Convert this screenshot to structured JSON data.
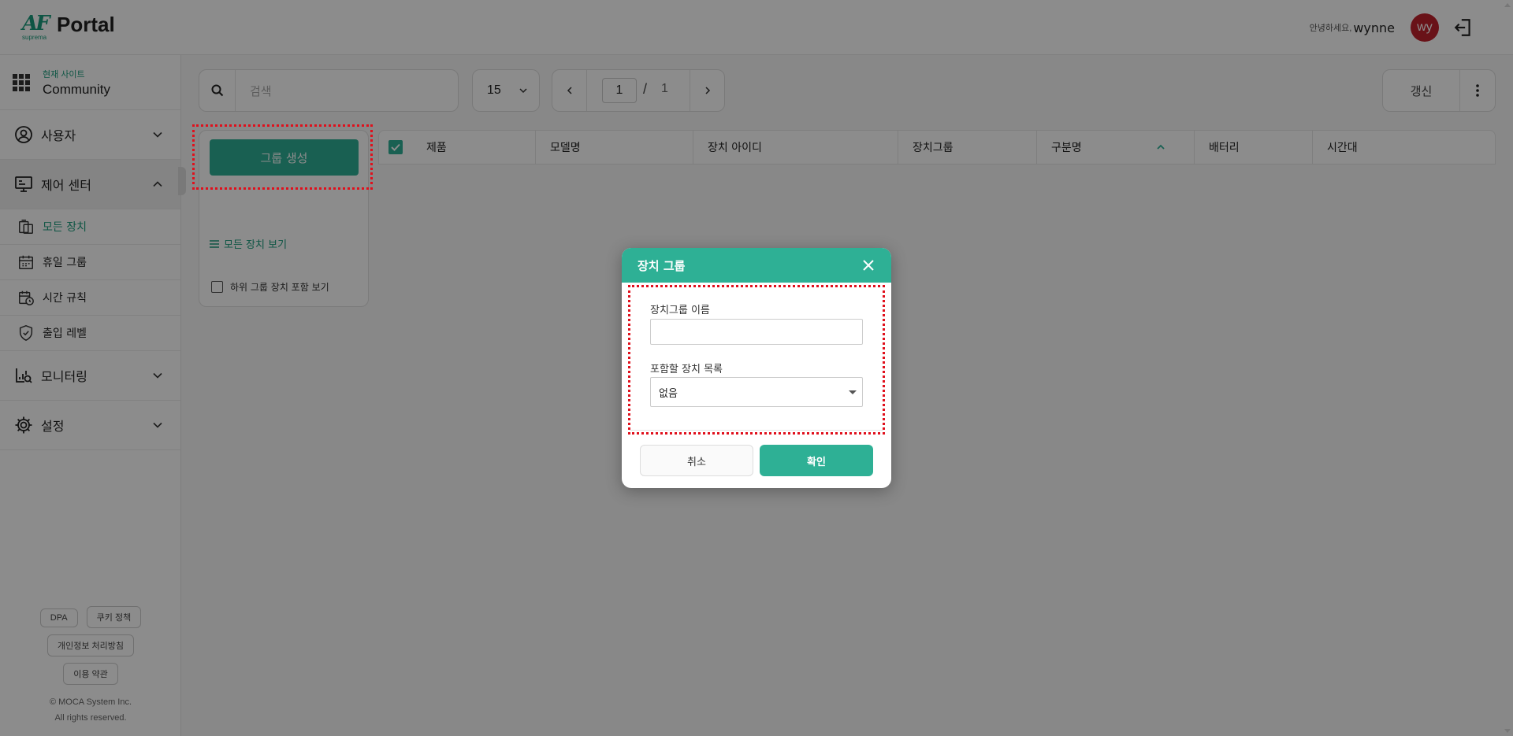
{
  "header": {
    "logo_sub": "suprema",
    "logo_text": "Portal",
    "greeting": "안녕하세요,",
    "username": "wynne",
    "avatar_initials": "wy"
  },
  "sidebar": {
    "site_label": "현재 사이트",
    "site_name": "Community",
    "items": [
      {
        "label": "사용자",
        "icon": "user-icon"
      },
      {
        "label": "제어 센터",
        "icon": "control-icon"
      },
      {
        "label": "모니터링",
        "icon": "monitor-icon"
      },
      {
        "label": "설정",
        "icon": "gear-icon"
      }
    ],
    "sub_items": [
      {
        "label": "모든 장치",
        "icon": "device-icon"
      },
      {
        "label": "휴일 그룹",
        "icon": "calendar-icon"
      },
      {
        "label": "시간 규칙",
        "icon": "time-rule-icon"
      },
      {
        "label": "출입 레벨",
        "icon": "shield-icon"
      }
    ],
    "footer": {
      "dpa": "DPA",
      "cookie": "쿠키 정책",
      "privacy": "개인정보 처리방침",
      "terms": "이용 약관",
      "copyright_line1": "© MOCA System Inc.",
      "copyright_line2": "All rights reserved."
    }
  },
  "toolbar": {
    "search_placeholder": "검색",
    "page_size": "15",
    "current_page": "1",
    "page_separator": "/",
    "total_pages": "1",
    "refresh_label": "갱신"
  },
  "group_panel": {
    "create_label": "그룹 생성",
    "all_devices_label": "모든 장치 보기",
    "include_sub_label": "하위 그룹 장치 포함 보기"
  },
  "table": {
    "columns": [
      "제품",
      "모델명",
      "장치 아이디",
      "장치그룹",
      "구분명",
      "배터리",
      "시간대"
    ]
  },
  "modal": {
    "title": "장치 그룹",
    "name_label": "장치그룹 이름",
    "name_value": "",
    "device_list_label": "포함할 장치 목록",
    "device_list_value": "없음",
    "cancel_label": "취소",
    "ok_label": "확인"
  },
  "colors": {
    "accent": "#2eb095",
    "brand": "#1a9b7c",
    "avatar": "#c0212c",
    "highlight": "#e0101c"
  }
}
